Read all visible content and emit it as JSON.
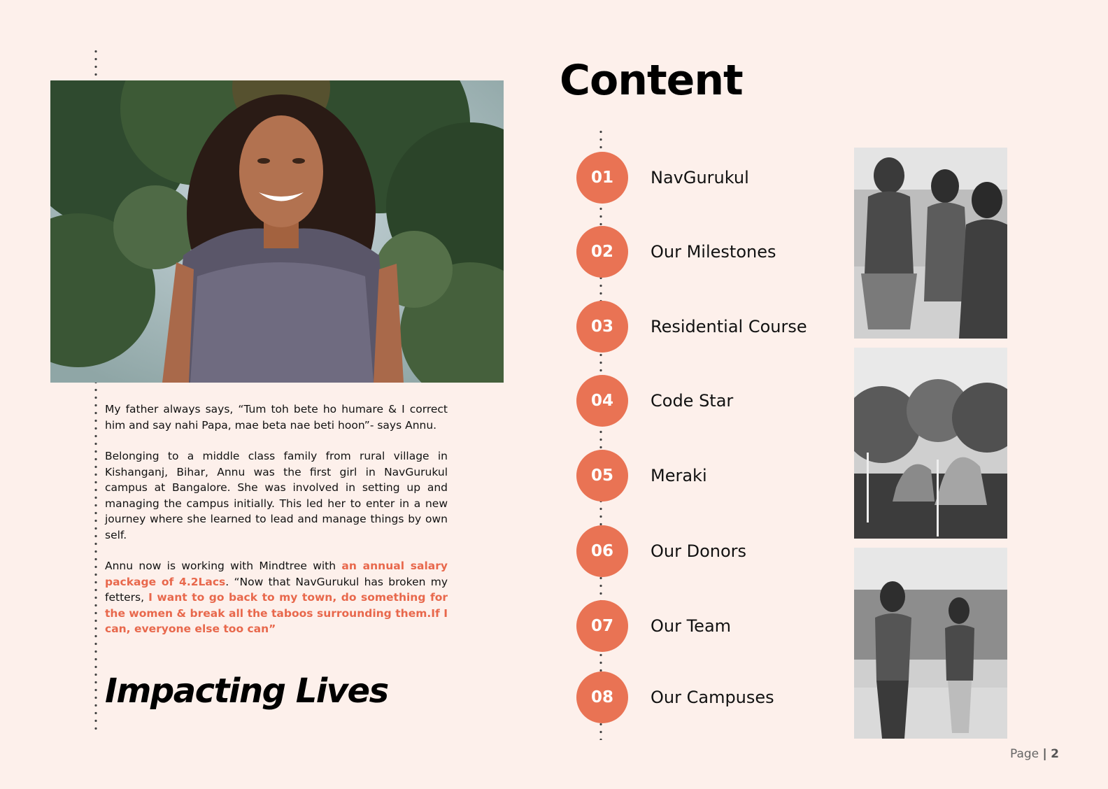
{
  "left": {
    "quote_paragraph_1": "My father always says, “Tum toh bete ho humare & I correct him and say nahi Papa, mae beta nae beti hoon”- says Annu.",
    "quote_paragraph_2": "Belonging to a middle class family from rural village in Kishanganj, Bihar, Annu was the first girl in NavGurukul campus at Bangalore. She was involved in setting up and managing the campus initially. This led her to enter in a new journey where she learned to lead and manage things by own self.",
    "quote_paragraph_3_a": "Annu now is working with Mindtree with ",
    "quote_paragraph_3_b": "an annual salary package of 4.2Lacs",
    "quote_paragraph_3_c": ". “Now that NavGurukul has broken my fetters, ",
    "quote_paragraph_3_d": "I want to go back to my town, do something for the women & break all the taboos surrounding them.If I can, everyone else too can”",
    "section_title": "Impacting Lives"
  },
  "content": {
    "title": "Content",
    "items": [
      {
        "number": "01",
        "label": "NavGurukul"
      },
      {
        "number": "02",
        "label": "Our Milestones"
      },
      {
        "number": "03",
        "label": "Residential Course"
      },
      {
        "number": "04",
        "label": "Code Star"
      },
      {
        "number": "05",
        "label": "Meraki"
      },
      {
        "number": "06",
        "label": "Our Donors"
      },
      {
        "number": "07",
        "label": "Our Team"
      },
      {
        "number": "08",
        "label": "Our Campuses"
      }
    ]
  },
  "footer": {
    "page_label": "Page",
    "separator": "|",
    "page_number": "2"
  },
  "colors": {
    "background": "#fdf0eb",
    "accent": "#e97354",
    "highlight_text": "#e8684c"
  }
}
